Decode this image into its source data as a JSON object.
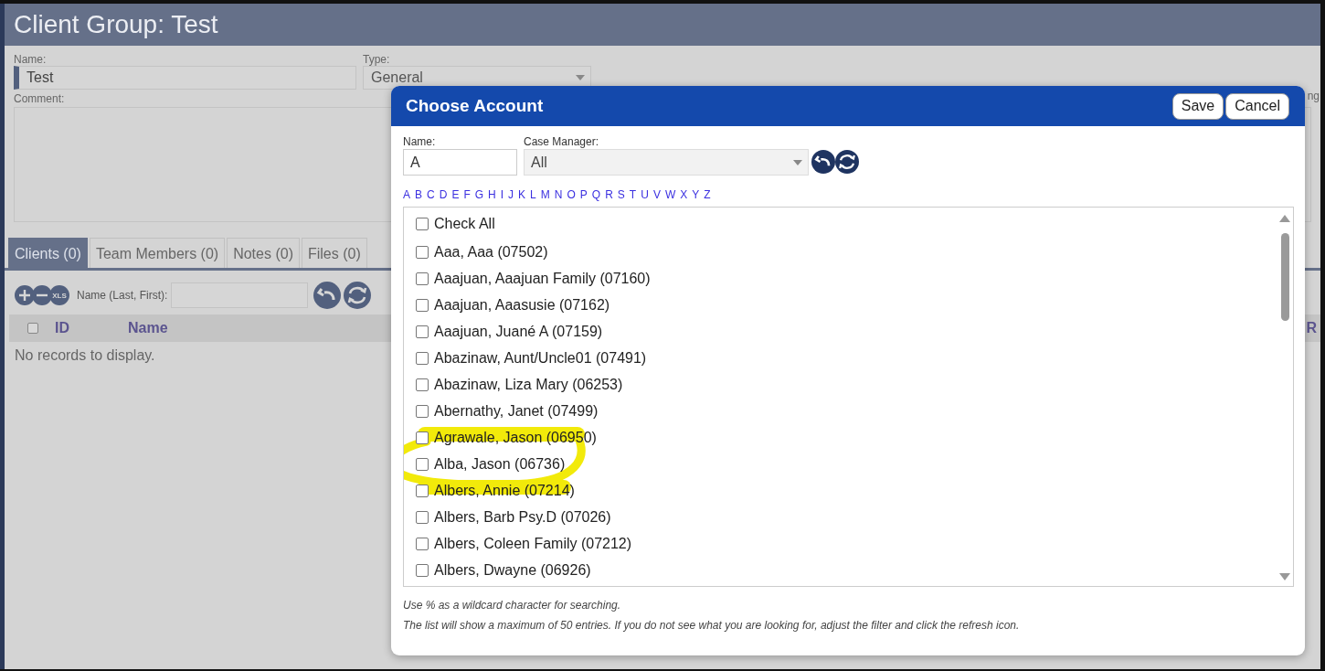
{
  "page": {
    "title": "Client Group: Test",
    "name_field": {
      "label": "Name:",
      "value": "Test"
    },
    "type_field": {
      "label": "Type:",
      "value": "General"
    },
    "comment_field": {
      "label": "Comment:"
    },
    "right_label": "ng",
    "tabs": [
      {
        "label": "Clients (0)",
        "selected": true
      },
      {
        "label": "Team Members (0)",
        "selected": false
      },
      {
        "label": "Notes (0)",
        "selected": false
      },
      {
        "label": "Files (0)",
        "selected": false
      }
    ],
    "toolbar": {
      "xls_label": "XLS",
      "filter_label": "Name (Last, First):"
    },
    "table": {
      "header_checked": false,
      "columns": [
        "ID",
        "Name"
      ],
      "column_cut": "R",
      "empty": "No records to display."
    }
  },
  "dialog": {
    "title": "Choose Account",
    "buttons": [
      "Save",
      "Cancel"
    ],
    "name_field": {
      "label": "Name:",
      "value": "A"
    },
    "manager_field": {
      "label": "Case Manager:",
      "value": "All"
    },
    "letters": [
      "A",
      "B",
      "C",
      "D",
      "E",
      "F",
      "G",
      "H",
      "I",
      "J",
      "K",
      "L",
      "M",
      "N",
      "O",
      "P",
      "Q",
      "R",
      "S",
      "T",
      "U",
      "V",
      "W",
      "X",
      "Y",
      "Z"
    ],
    "check_all": {
      "label": "Check All",
      "checked": false
    },
    "accounts": [
      {
        "label": "Aaa, Aaa (07502)",
        "checked": false
      },
      {
        "label": "Aaajuan, Aaajuan Family (07160)",
        "checked": false
      },
      {
        "label": "Aaajuan, Aaasusie (07162)",
        "checked": false
      },
      {
        "label": "Aaajuan, Juané A (07159)",
        "checked": false
      },
      {
        "label": "Abazinaw, Aunt/Uncle01 (07491)",
        "checked": false
      },
      {
        "label": "Abazinaw, Liza Mary (06253)",
        "checked": false
      },
      {
        "label": "Abernathy, Janet (07499)",
        "checked": false
      },
      {
        "label": "Agrawale, Jason (06950)",
        "checked": false
      },
      {
        "label": "Alba, Jason (06736)",
        "checked": false
      },
      {
        "label": "Albers, Annie (07214)",
        "checked": false
      },
      {
        "label": "Albers, Barb Psy.D (07026)",
        "checked": false
      },
      {
        "label": "Albers, Coleen Family (07212)",
        "checked": false
      },
      {
        "label": "Albers, Dwayne (06926)",
        "checked": false
      }
    ],
    "notes": [
      "Use % as a wildcard character for searching.",
      "The list will show a maximum of 50 entries. If you do not see what you are looking for, adjust the filter and click the refresh icon."
    ]
  }
}
